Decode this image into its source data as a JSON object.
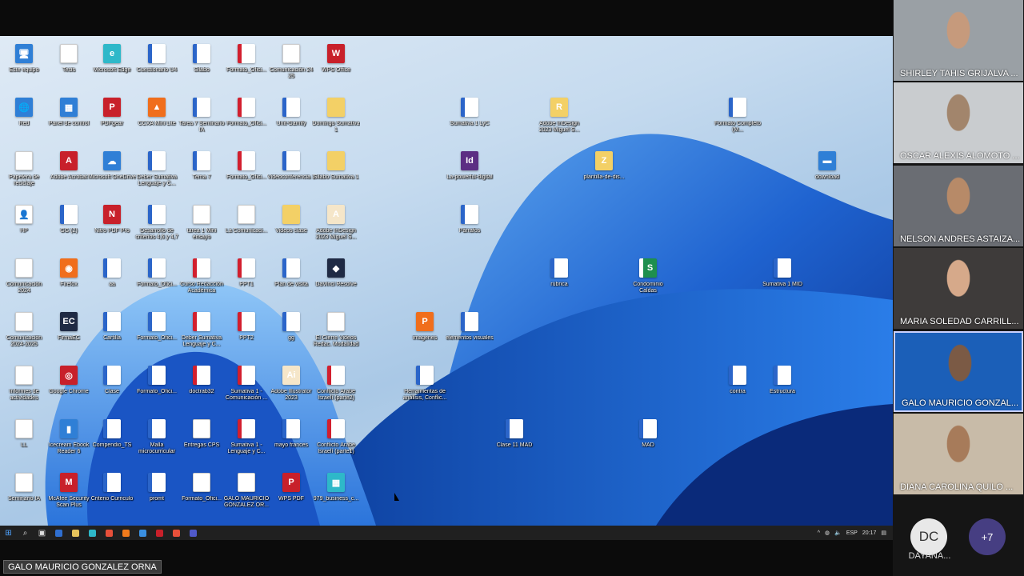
{
  "desktop_icons": [
    {
      "label": "Este equipo",
      "kind": "blue",
      "symbol": "🖥"
    },
    {
      "label": "Tesis",
      "kind": "file",
      "symbol": "▤"
    },
    {
      "label": "Microsoft Edge",
      "kind": "teal",
      "symbol": "e"
    },
    {
      "label": "Cuestionario U4",
      "kind": "word",
      "symbol": "W"
    },
    {
      "label": "Silabo",
      "kind": "word",
      "symbol": "W"
    },
    {
      "label": "Formato_Ofici...",
      "kind": "pdf",
      "symbol": "▤"
    },
    {
      "label": "Comunicación 24 25",
      "kind": "file",
      "symbol": "▤"
    },
    {
      "label": "WPS Office",
      "kind": "red",
      "symbol": "W"
    },
    {
      "label": "Red",
      "kind": "blue",
      "symbol": "🌐"
    },
    {
      "label": "Panel de control",
      "kind": "blue",
      "symbol": "▦"
    },
    {
      "label": "PDFgear",
      "kind": "red",
      "symbol": "P"
    },
    {
      "label": "CCXA Mini Lite",
      "kind": "orange",
      "symbol": "▲"
    },
    {
      "label": "Tarea 7 Seminario IA",
      "kind": "word",
      "symbol": "W"
    },
    {
      "label": "Formato_Ofici...",
      "kind": "pdf",
      "symbol": "P"
    },
    {
      "label": "Unit-Gamify",
      "kind": "word",
      "symbol": "W"
    },
    {
      "label": "Domingo Sumativa 1",
      "kind": "folder",
      "symbol": ""
    },
    {
      "label": "Sumativa 1 LyC",
      "kind": "word",
      "symbol": "W"
    },
    {
      "label": "Adobe InDesign 2023 Miguel S...",
      "kind": "folder",
      "symbol": "R"
    },
    {
      "label": "Formato Completo (M...",
      "kind": "word",
      "symbol": "W"
    },
    {
      "label": "Papelera de reciclaje",
      "kind": "file",
      "symbol": "🗑"
    },
    {
      "label": "Adobe Acrobat",
      "kind": "red",
      "symbol": "A"
    },
    {
      "label": "Microsoft OneDrive",
      "kind": "blue",
      "symbol": "☁"
    },
    {
      "label": "Deber Sumativa Lenguaje y C...",
      "kind": "word",
      "symbol": "W"
    },
    {
      "label": "Tema 7",
      "kind": "word",
      "symbol": "W"
    },
    {
      "label": "Formato_Ofici...",
      "kind": "pdf",
      "symbol": "P"
    },
    {
      "label": "Videoconferencia 1",
      "kind": "word",
      "symbol": "W"
    },
    {
      "label": "Silabo Sumativa 1",
      "kind": "folder",
      "symbol": ""
    },
    {
      "label": "La-powerful-digital",
      "kind": "purple",
      "symbol": "Id"
    },
    {
      "label": "plantilla-de-dis...",
      "kind": "folder",
      "symbol": "Z"
    },
    {
      "label": "download",
      "kind": "blue",
      "symbol": "▬"
    },
    {
      "label": "HP",
      "kind": "file",
      "symbol": "👤"
    },
    {
      "label": "GG (2)",
      "kind": "word",
      "symbol": "W"
    },
    {
      "label": "Nitro PDF Pro",
      "kind": "red",
      "symbol": "N"
    },
    {
      "label": "Desarrollo de criterios 4,6 y 4,7",
      "kind": "word",
      "symbol": "W"
    },
    {
      "label": "tarea 1 Mini ensayo",
      "kind": "file",
      "symbol": "W"
    },
    {
      "label": "La Comunicaci...",
      "kind": "file",
      "symbol": "▭"
    },
    {
      "label": "Videos clase",
      "kind": "folder",
      "symbol": ""
    },
    {
      "label": "Adobe InDesign 2023 Miguel S...",
      "kind": "ai",
      "symbol": "A"
    },
    {
      "label": "Párrafos",
      "kind": "word",
      "symbol": "W"
    },
    {
      "label": "Comunicación 2024",
      "kind": "file",
      "symbol": "▤"
    },
    {
      "label": "Firefox",
      "kind": "orange",
      "symbol": "◉"
    },
    {
      "label": "aa",
      "kind": "word",
      "symbol": "W"
    },
    {
      "label": "Formato_Ofici...",
      "kind": "word",
      "symbol": "W"
    },
    {
      "label": "Curso Redacción Académica",
      "kind": "pdf",
      "symbol": "P"
    },
    {
      "label": "PPT1",
      "kind": "pdf",
      "symbol": "P"
    },
    {
      "label": "Plan de visita",
      "kind": "word",
      "symbol": "W"
    },
    {
      "label": "DaVinci Resolve",
      "kind": "dark",
      "symbol": "◆"
    },
    {
      "label": "rúbrica",
      "kind": "word",
      "symbol": "W"
    },
    {
      "label": "Condominio Caldas",
      "kind": "green",
      "symbol": "S"
    },
    {
      "label": "Sumativa 1 MID",
      "kind": "word",
      "symbol": "W"
    },
    {
      "label": "Comunicación 2024-2025",
      "kind": "file",
      "symbol": "▤"
    },
    {
      "label": "FirmaEC",
      "kind": "dark",
      "symbol": "EC"
    },
    {
      "label": "Cartilla",
      "kind": "word",
      "symbol": "W"
    },
    {
      "label": "Formato_Ofici...",
      "kind": "word",
      "symbol": "W"
    },
    {
      "label": "Deber Sumativa Lenguaje y C...",
      "kind": "pdf",
      "symbol": "P"
    },
    {
      "label": "PPT2",
      "kind": "pdf",
      "symbol": "P"
    },
    {
      "label": "gg",
      "kind": "word",
      "symbol": "W"
    },
    {
      "label": "El Cierre Videos Redac. Modalidad",
      "kind": "file",
      "symbol": "▭"
    },
    {
      "label": "imagenes",
      "kind": "orange",
      "symbol": "P"
    },
    {
      "label": "elementos visuales",
      "kind": "word",
      "symbol": "W"
    },
    {
      "label": "Informes de actividades",
      "kind": "file",
      "symbol": "▤"
    },
    {
      "label": "Google Chrome",
      "kind": "red",
      "symbol": "◎"
    },
    {
      "label": "Clase",
      "kind": "word",
      "symbol": "W"
    },
    {
      "label": "Formato_Ofici...",
      "kind": "word",
      "symbol": "W"
    },
    {
      "label": "doctrab32",
      "kind": "pdf",
      "symbol": "P"
    },
    {
      "label": "Sumativa 1 - Comunicación ...",
      "kind": "pdf",
      "symbol": "▤"
    },
    {
      "label": "Adobe Illustrator 2023",
      "kind": "ai",
      "symbol": "Ai"
    },
    {
      "label": "Conflicto Árabe Israelí (parte2)",
      "kind": "pdf",
      "symbol": "P"
    },
    {
      "label": "Herramientas de análisis, Conflic...",
      "kind": "word",
      "symbol": "W"
    },
    {
      "label": "contra",
      "kind": "word",
      "symbol": "W"
    },
    {
      "label": "Estructura",
      "kind": "word",
      "symbol": "W"
    },
    {
      "label": "LL",
      "kind": "file",
      "symbol": "▤"
    },
    {
      "label": "Icecream Ebook Reader 6",
      "kind": "blue",
      "symbol": "▮"
    },
    {
      "label": "Compendio_TS",
      "kind": "word",
      "symbol": "W"
    },
    {
      "label": "Malla microcurricular",
      "kind": "word",
      "symbol": "W"
    },
    {
      "label": "Entregas CPS",
      "kind": "file",
      "symbol": "▤"
    },
    {
      "label": "Sumativa 1 - Lenguaje y C...",
      "kind": "pdf",
      "symbol": "▤"
    },
    {
      "label": "mayo frances",
      "kind": "word",
      "symbol": "W"
    },
    {
      "label": "Conflicto Árabe Israelí (parte1)",
      "kind": "pdf",
      "symbol": "P"
    },
    {
      "label": "Clase 11 MAD",
      "kind": "word",
      "symbol": "W"
    },
    {
      "label": "MAD",
      "kind": "word",
      "symbol": "W"
    },
    {
      "label": "Seminario IA",
      "kind": "file",
      "symbol": "▮"
    },
    {
      "label": "McAfee Security Scan Plus",
      "kind": "red",
      "symbol": "M"
    },
    {
      "label": "Criterio Curriculo",
      "kind": "word",
      "symbol": "W"
    },
    {
      "label": "promt",
      "kind": "word",
      "symbol": "W"
    },
    {
      "label": "Formato_Ofici...",
      "kind": "file",
      "symbol": "▤"
    },
    {
      "label": "GALO MAURICIO GONZALEZ OR...",
      "kind": "file",
      "symbol": "✉"
    },
    {
      "label": "WPS PDF",
      "kind": "red",
      "symbol": "P"
    },
    {
      "label": "979_business_c...",
      "kind": "teal",
      "symbol": "▦"
    }
  ],
  "taskbar": {
    "items": [
      {
        "name": "start-button",
        "symbol": "⊞",
        "color": "#4fa3ff"
      },
      {
        "name": "search-icon",
        "symbol": "⌕",
        "color": "#ddd"
      },
      {
        "name": "task-view-icon",
        "symbol": "▣",
        "color": "#ddd"
      },
      {
        "name": "taskbar-app",
        "symbol": "",
        "color": "#2f6fd0"
      },
      {
        "name": "taskbar-app",
        "symbol": "",
        "color": "#e6c35c"
      },
      {
        "name": "taskbar-app",
        "symbol": "",
        "color": "#2eb8c9"
      },
      {
        "name": "taskbar-app",
        "symbol": "",
        "color": "#e8503a"
      },
      {
        "name": "taskbar-app",
        "symbol": "",
        "color": "#f07a1c"
      },
      {
        "name": "taskbar-app",
        "symbol": "",
        "color": "#3a8fe0"
      },
      {
        "name": "taskbar-app",
        "symbol": "",
        "color": "#c8202a"
      },
      {
        "name": "taskbar-app",
        "symbol": "",
        "color": "#e8503a"
      },
      {
        "name": "taskbar-app",
        "symbol": "",
        "color": "#5059c9"
      }
    ],
    "language": "ESP",
    "time": "20:17"
  },
  "participants": [
    {
      "name": "SHIRLEY TAHIS GRIJALVA ...",
      "bg": "#9aa0a5",
      "face": "#c69a7c",
      "active": false
    },
    {
      "name": "OSCAR ALEXIS ALOMOTO ...",
      "bg": "#c9cccf",
      "face": "#a2856c",
      "active": false
    },
    {
      "name": "NELSON ANDRES ASTAIZA...",
      "bg": "#6a6d73",
      "face": "#b78a68",
      "active": false
    },
    {
      "name": "MARIA SOLEDAD CARRILL...",
      "bg": "#3e3b3a",
      "face": "#d6a98a",
      "active": false
    },
    {
      "name": "GALO MAURICIO GONZAL...",
      "bg": "#1b5fb8",
      "face": "#7b5a45",
      "active": true
    },
    {
      "name": "DIANA CAROLINA QUILO ...",
      "bg": "#c8bba8",
      "face": "#a77b5a",
      "active": false
    }
  ],
  "extra_participant": {
    "initials": "DC",
    "name": "DAYANA..."
  },
  "more_count": "+7",
  "presenter_label": "GALO MAURICIO GONZALEZ  ORNA"
}
